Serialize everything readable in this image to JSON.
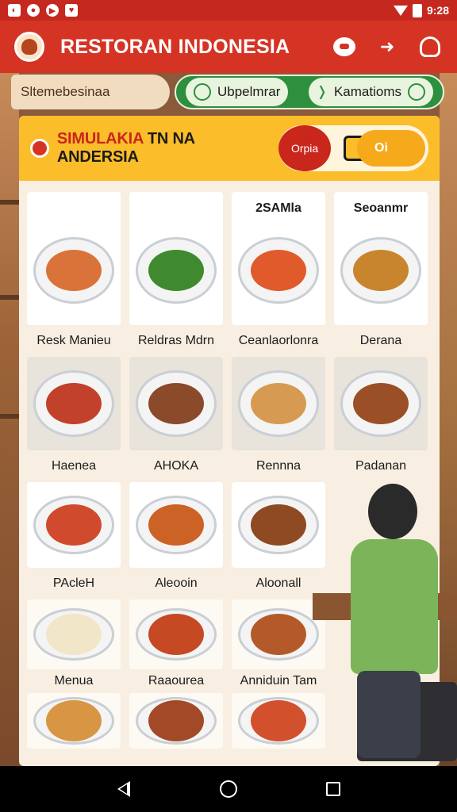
{
  "status_bar": {
    "time": "9:28"
  },
  "app_bar": {
    "title": "RESTORAN INDONESIA"
  },
  "tabs": {
    "first": "Sltemebesinaa",
    "second": "Ubpelmrar",
    "third": "Kamatioms"
  },
  "banner": {
    "title_highlight": "SIMULAKIA",
    "title_rest": " TN NA ANDERSIA",
    "pill_button": "Orpia",
    "pill_value": "Oi"
  },
  "grid": {
    "row1": [
      {
        "head": "",
        "label": "Resk Manieu",
        "color": "#d9733a"
      },
      {
        "head": "",
        "label": "Reldras Mdrn",
        "color": "#3f8a2e"
      },
      {
        "head": "2SAMla",
        "label": "Ceanlaorlonra",
        "color": "#e05a2b"
      },
      {
        "head": "Seoanmr",
        "label": "Derana",
        "color": "#c9852d"
      }
    ],
    "row2": [
      {
        "label": "Haenea",
        "color": "#c1412a"
      },
      {
        "label": "AHOKA",
        "color": "#8b4a2a"
      },
      {
        "label": "Rennna",
        "color": "#d79a52"
      },
      {
        "label": "Padanan",
        "color": "#9a4f26"
      }
    ],
    "row3": [
      {
        "label": "PAcleH",
        "color": "#d04b2e"
      },
      {
        "label": "Aleooin",
        "color": "#cc6226"
      },
      {
        "label": "Aloonall",
        "color": "#8d4a23"
      }
    ],
    "row4": [
      {
        "label": "Menua",
        "color": "#f2e6c8"
      },
      {
        "label": "Raaourea",
        "color": "#c54a24"
      },
      {
        "label": "Anniduin Tam",
        "color": "#b45a2a"
      }
    ],
    "row5": [
      {
        "color": "#d89543"
      },
      {
        "color": "#a24a28"
      },
      {
        "color": "#d2502c"
      }
    ]
  },
  "colors": {
    "brand_red": "#d53424",
    "accent_yellow": "#fbbd2a",
    "tab_green": "#2e8f3f"
  }
}
